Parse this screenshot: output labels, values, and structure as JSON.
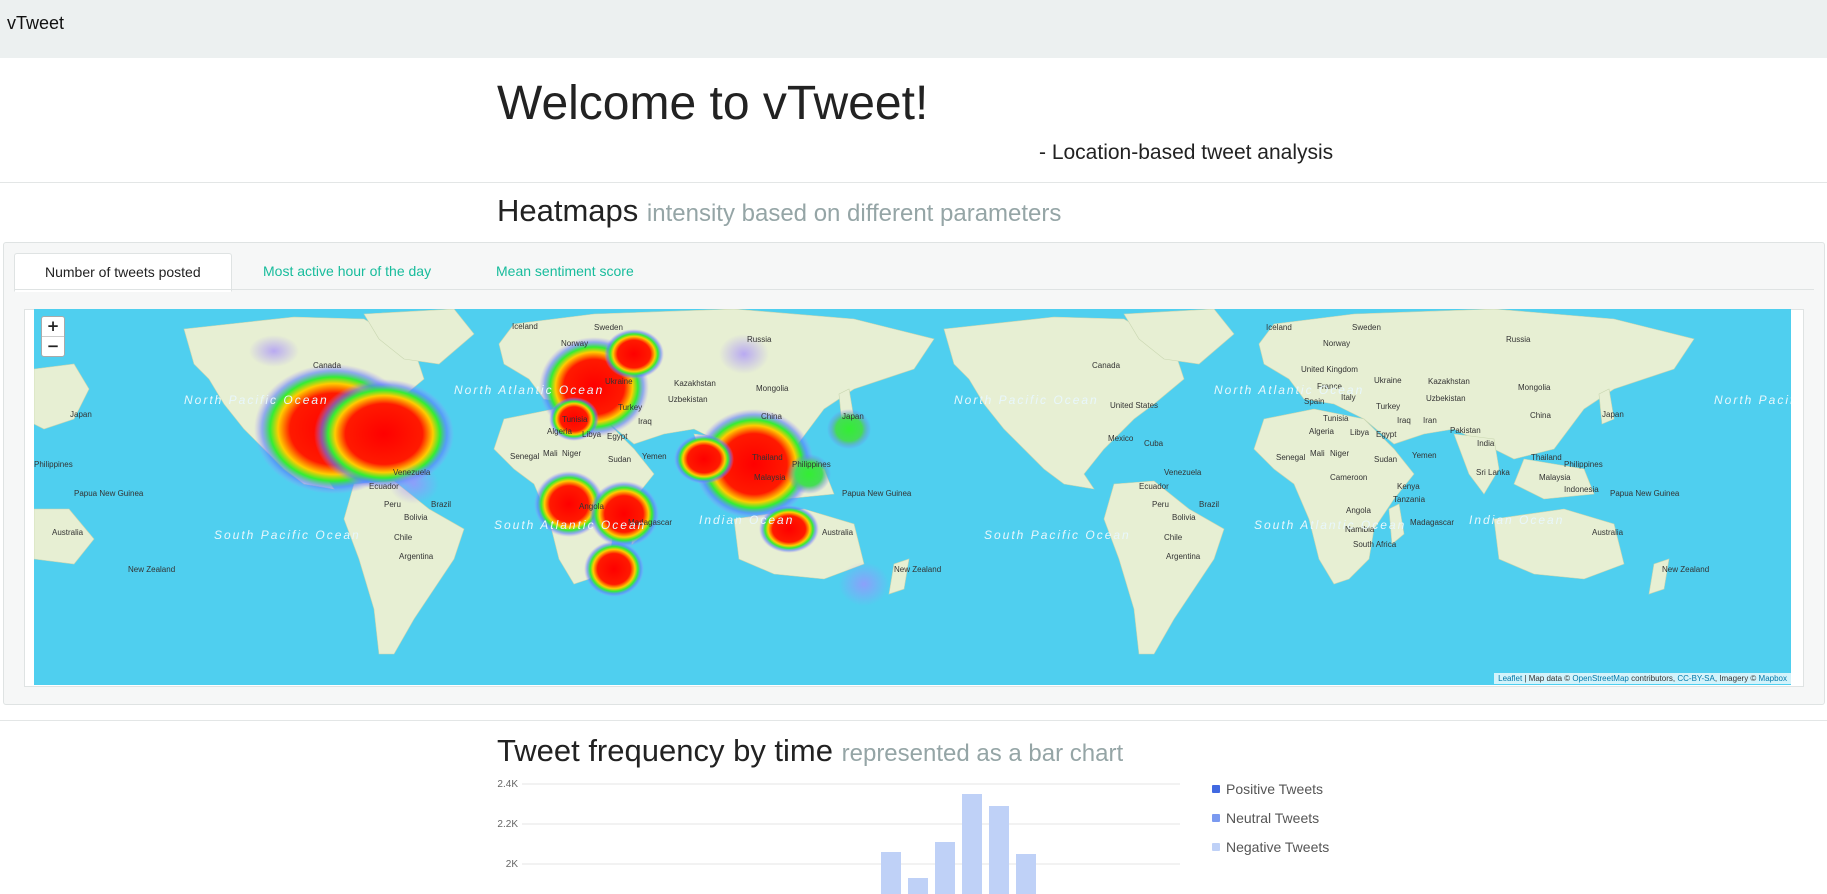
{
  "navbar": {
    "brand": "vTweet"
  },
  "hero": {
    "title": "Welcome to vTweet!",
    "subtitle": "- Location-based tweet analysis"
  },
  "heatmaps": {
    "title": "Heatmaps",
    "subtitle": "intensity based on different parameters",
    "tabs": [
      {
        "label": "Number of tweets posted",
        "active": true
      },
      {
        "label": "Most active hour of the day",
        "active": false
      },
      {
        "label": "Mean sentiment score",
        "active": false
      }
    ],
    "map": {
      "zoom_in": "+",
      "zoom_out": "−",
      "attribution": {
        "leaflet": "Leaflet",
        "sep1": " | Map data © ",
        "osm": "OpenStreetMap",
        "sep2": " contributors, ",
        "license": "CC-BY-SA",
        "sep3": ", Imagery © ",
        "mapbox": "Mapbox"
      },
      "labels": {
        "iceland": "Iceland",
        "sweden": "Sweden",
        "norway": "Norway",
        "russia": "Russia",
        "canada": "Canada",
        "ukraine": "Ukraine",
        "kazakhstan": "Kazakhstan",
        "mongolia": "Mongolia",
        "uzbekistan": "Uzbekistan",
        "turkey": "Turkey",
        "china": "China",
        "japan": "Japan",
        "algeria": "Algeria",
        "libya": "Libya",
        "egypt": "Egypt",
        "tunisia": "Tunisia",
        "iraq": "Iraq",
        "senegal": "Senegal",
        "mali": "Mali",
        "niger": "Niger",
        "sudan": "Sudan",
        "yemen": "Yemen",
        "thailand": "Thailand",
        "philippines": "Philippines",
        "malaysia": "Malaysia",
        "venezuela": "Venezuela",
        "ecuador": "Ecuador",
        "peru": "Peru",
        "brazil": "Brazil",
        "bolivia": "Bolivia",
        "chile": "Chile",
        "argentina": "Argentina",
        "angola": "Angola",
        "namibia": "Namibia",
        "madagascar": "Madagascar",
        "australia": "Australia",
        "new_zealand": "New Zealand",
        "papua": "Papua New Guinea",
        "indonesia": "Indonesia",
        "united_states": "United States",
        "mexico": "Mexico",
        "cuba": "Cuba",
        "united_kingdom": "United Kingdom",
        "france": "France",
        "spain": "Spain",
        "italy": "Italy",
        "iran": "Iran",
        "pakistan": "Pakistan",
        "india": "India",
        "sri_lanka": "Sri Lanka",
        "cameroon": "Cameroon",
        "kenya": "Kenya",
        "tanzania": "Tanzania",
        "south_africa": "South Africa",
        "north_pacific": "North Pacific Ocean",
        "north_atlantic": "North Atlantic Ocean",
        "south_pacific": "South Pacific Ocean",
        "south_atlantic": "South Atlantic Ocean",
        "indian_ocean": "Indian Ocean"
      }
    }
  },
  "frequency": {
    "title": "Tweet frequency by time",
    "subtitle": "represented as a bar chart"
  },
  "chart_data": {
    "type": "bar",
    "yticks": [
      "2.4K",
      "2.2K",
      "2K"
    ],
    "ytick_values": [
      2400,
      2200,
      2000
    ],
    "ylim_visible": [
      1850,
      2430
    ],
    "series": [
      {
        "name": "Positive Tweets",
        "color": "#4169e1"
      },
      {
        "name": "Neutral Tweets",
        "color": "#7b9af0"
      },
      {
        "name": "Negative Tweets",
        "color": "#bfd1f7",
        "values": [
          2060,
          1930,
          2110,
          2350,
          2290,
          2050
        ]
      }
    ]
  }
}
